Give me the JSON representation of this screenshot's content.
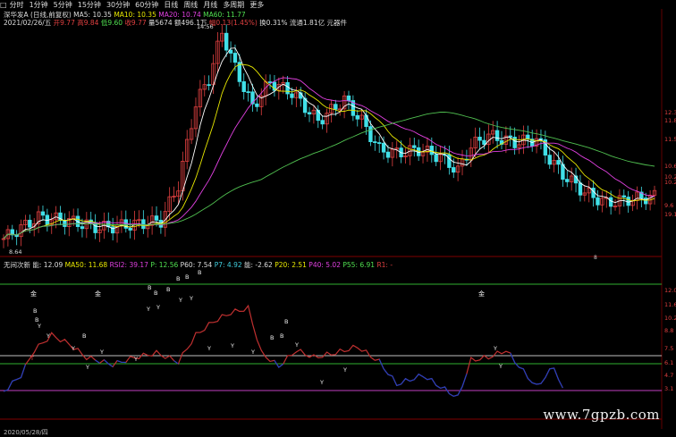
{
  "toolbar": {
    "items": [
      "分时",
      "1分钟",
      "5分钟",
      "15分钟",
      "30分钟",
      "60分钟",
      "日线",
      "周线",
      "月线",
      "多周期",
      "更多"
    ]
  },
  "main_header": {
    "name": "深华发A (日线,前复权)",
    "ma5": "MA5: 10.35",
    "ma10": "MA10: 10.35",
    "ma20": "MA20: 10.74",
    "ma60": "MA60: 11.77"
  },
  "quote_line": {
    "date": "2021/02/26/五",
    "open": "开9.77",
    "high": "高9.84",
    "low": "低9.60",
    "close": "收9.77",
    "volume": "量5674",
    "amount": "额496.1万",
    "change": "幅0.13(1.45%)",
    "turnover": "换0.31%",
    "float": "流通1.81亿",
    "sector": "元器件"
  },
  "price_labels": {
    "high_mark": "14.56",
    "low_mark": "8.64"
  },
  "price_axis": [
    "12.3",
    "11.8",
    "11.5",
    "10.6",
    "10.2",
    "9.6",
    "19.1"
  ],
  "indicator_header": {
    "name": "无间次新",
    "v1": "能: 12.09",
    "v2": "MA50: 11.68",
    "v3": "RSI2: 39.17",
    "v4": "P: 12.56",
    "v5": "P60: 7.54",
    "v6": "P7: 4.92",
    "v7": "能: -2.62",
    "v8": "P20: 2.51",
    "v9": "P40: 5.02",
    "v10": "P55: 6.91",
    "v11": "R1: -"
  },
  "indicator_axis": [
    "12.0",
    "11.6",
    "10.2",
    "8.8",
    "7.5",
    "6.1",
    "4.7",
    "3.1"
  ],
  "markers": {
    "gold": "金",
    "buy": "B",
    "sell": "Y",
    "t": "T"
  },
  "bottom": {
    "date_label": "2020/05/28/四",
    "axis_mark": "8"
  },
  "watermark": "www.7gpzb.com",
  "colors": {
    "background": "#000000",
    "up_candle": "#e04040",
    "down_candle": "#40e0e8",
    "ma5": "#ffffff",
    "ma10": "#e8e800",
    "ma20": "#e040e0",
    "ma60": "#50c050",
    "indicator_line": "#c03030",
    "indicator_low": "#2040c0"
  }
}
